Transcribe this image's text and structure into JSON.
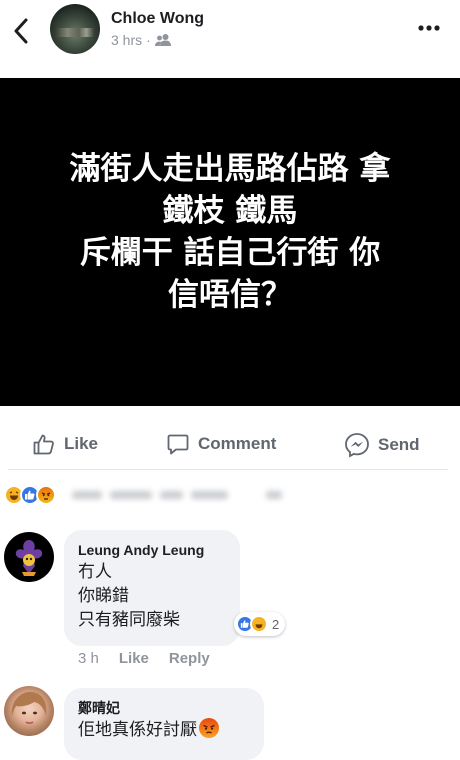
{
  "header": {
    "author_name": "Chloe Wong",
    "time": "3 hrs",
    "separator": "·",
    "audience_icon": "friends-icon",
    "back_icon": "chevron-left-icon",
    "more_icon": "more-dots-icon"
  },
  "post": {
    "image_text": "滿街人走出馬路佔路 拿\n鐵枝 鐵馬\n斥欄干 話自己行街 你\n信唔信？",
    "image_background": "#000000"
  },
  "actions": {
    "like_label": "Like",
    "comment_label": "Comment",
    "send_label": "Send"
  },
  "reactions_summary": {
    "icons": [
      "haha-icon",
      "like-icon",
      "angry-icon"
    ]
  },
  "comments": [
    {
      "author": "Leung Andy Leung",
      "text": "冇人\n你睇錯\n只有豬同廢柴",
      "reaction_icons": [
        "like-icon",
        "haha-icon"
      ],
      "reaction_count": "2",
      "time": "3 h",
      "like_label": "Like",
      "reply_label": "Reply"
    },
    {
      "author": "鄭晴妃",
      "text": "佢地真係好討厭",
      "emoji": "angry-face-emoji"
    }
  ],
  "colors": {
    "text_primary": "#1c1e21",
    "text_secondary": "#90949c",
    "action_gray": "#606770",
    "bubble_bg": "#f0f2f5",
    "like_blue": "#3578e5",
    "haha_yellow": "#f7b125"
  }
}
